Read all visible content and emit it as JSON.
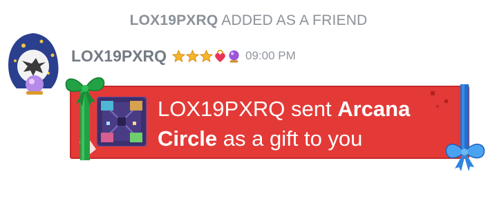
{
  "system_message": {
    "user": "LOX19PXRQ",
    "text": "ADDED AS A FRIEND"
  },
  "message": {
    "username": "LOX19PXRQ",
    "time": "09:00 PM",
    "badges": [
      "star-icon",
      "star-icon",
      "star-icon",
      "heart-lock-icon",
      "crystal-ball-icon"
    ]
  },
  "gift": {
    "sender": "LOX19PXRQ",
    "sent_text": "sent",
    "item_line1": "Arcana",
    "item_line2": "Circle",
    "suffix": "as a gift to you"
  },
  "colors": {
    "card_red": "#e33a37",
    "ribbon_green": "#22a244",
    "ribbon_blue": "#1f6fd1",
    "meta_gray": "#8b9199"
  }
}
